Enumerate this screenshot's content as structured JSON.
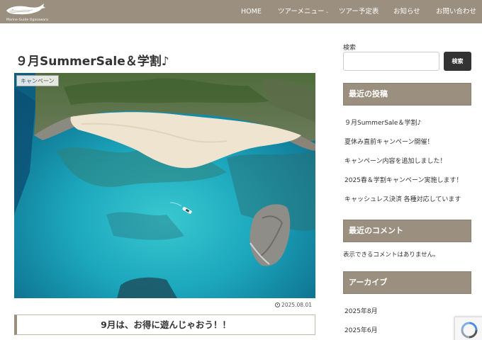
{
  "header": {
    "logo_text": "Marine Guide Ogasawara",
    "nav": [
      "HOME",
      "ツアーメニュー",
      "ツアー予定表",
      "お知らせ",
      "お問い合わせ"
    ],
    "dropdown_icon": "chevron-down-icon",
    "background": "#9b907f"
  },
  "article": {
    "title": "９月SummerSale＆学割♪",
    "category": "キャンペーン",
    "date": "2025.08.01",
    "image_alt": "aerial photo of beach and coral reef",
    "subheading": "9月は、お得に遊んじゃおう！！"
  },
  "sidebar": {
    "search_label": "検索",
    "search_value": "",
    "search_button": "検索",
    "recent_posts_title": "最近の投稿",
    "recent_posts": [
      "９月SummerSale＆学割♪",
      "夏休み直前キャンペーン開催！",
      "キャンペーン内容を追加しました！",
      "2025春＆学割キャンペーン実施します！",
      "キャッシュレス決済 各種対応しています"
    ],
    "recent_comments_title": "最近のコメント",
    "no_comments": "表示できるコメントはありません。",
    "archive_title": "アーカイブ",
    "archives": [
      "2025年8月",
      "2025年6月"
    ]
  },
  "colors": {
    "accent": "#9b907f",
    "button": "#333333",
    "sea": "#1fa7b5"
  }
}
